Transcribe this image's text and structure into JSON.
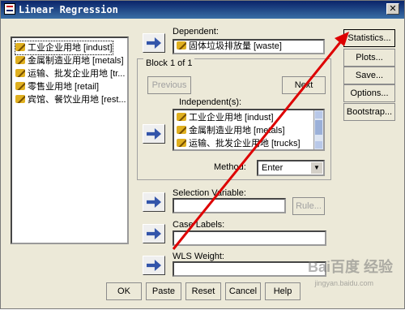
{
  "window": {
    "title": "Linear Regression"
  },
  "variables": [
    "工业企业用地 [indust]",
    "金属制造业用地 [metals]",
    "运输、批发企业用地 [tr...",
    "零售业用地 [retail]",
    "宾馆、餐饮业用地 [rest..."
  ],
  "dependent": {
    "label": "Dependent:",
    "value": "固体垃圾排放量 [waste]"
  },
  "block": {
    "label": "Block 1 of 1",
    "previous": "Previous",
    "next": "Next"
  },
  "independent": {
    "label": "Independent(s):",
    "items": [
      "工业企业用地 [indust]",
      "金属制造业用地 [metals]",
      "运输、批发企业用地 [trucks]"
    ]
  },
  "method": {
    "label": "Method:",
    "value": "Enter"
  },
  "selection": {
    "label": "Selection Variable:",
    "rule": "Rule..."
  },
  "case_labels": {
    "label": "Case Labels:"
  },
  "wls": {
    "label": "WLS Weight:"
  },
  "side_buttons": [
    "Statistics...",
    "Plots...",
    "Save...",
    "Options...",
    "Bootstrap..."
  ],
  "bottom_buttons": [
    "OK",
    "Paste",
    "Reset",
    "Cancel",
    "Help"
  ],
  "watermark": {
    "text": "Bai百度 经验",
    "url": "jingyan.baidu.com"
  },
  "annotation": {
    "arrow_color": "#DD0000"
  }
}
